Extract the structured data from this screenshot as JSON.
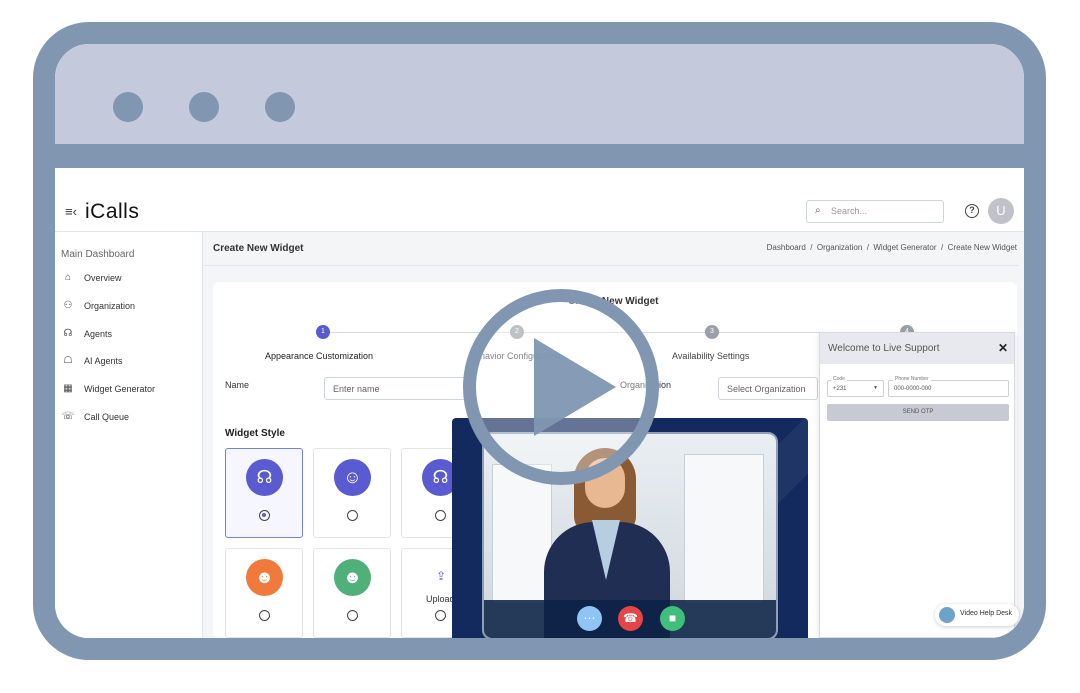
{
  "app": {
    "logo": "iCalls",
    "search_placeholder": "Search...",
    "avatar_initial": "U",
    "help_glyph": "?"
  },
  "sidebar": {
    "title": "Main Dashboard",
    "items": [
      {
        "label": "Overview",
        "icon": "home-icon"
      },
      {
        "label": "Organization",
        "icon": "users-icon"
      },
      {
        "label": "Agents",
        "icon": "headset-icon"
      },
      {
        "label": "AI Agents",
        "icon": "robot-icon"
      },
      {
        "label": "Widget Generator",
        "icon": "grid-icon"
      },
      {
        "label": "Call Queue",
        "icon": "phone-icon"
      }
    ]
  },
  "page": {
    "title": "Create New Widget",
    "breadcrumb": "Dashboard  /  Organization  /  Widget Generator  /  Create New Widget"
  },
  "form": {
    "card_title": "Create New Widget",
    "steps": [
      {
        "num": "1",
        "label": "Appearance Customization"
      },
      {
        "num": "2",
        "label": "Behavior Configuration"
      },
      {
        "num": "3",
        "label": "Availability Settings"
      },
      {
        "num": "4",
        "label": ""
      }
    ],
    "name_label": "Name",
    "name_placeholder": "Enter name",
    "org_label": "Organization",
    "org_placeholder": "Select Organization",
    "widget_style_title": "Widget Style",
    "upload_label": "Upload"
  },
  "support_widget": {
    "title": "Welcome to Live Support",
    "code_label": "Code",
    "code_value": "+231",
    "phone_label": "Phone Number",
    "phone_placeholder": "000-0000-000",
    "button": "SEND OTP",
    "video_help": "Video Help Desk"
  },
  "colors": {
    "frame": "#8096b1",
    "titlebar": "#c5c9dc",
    "accent": "#5a5ad1",
    "video_bg": "#132a5e"
  }
}
